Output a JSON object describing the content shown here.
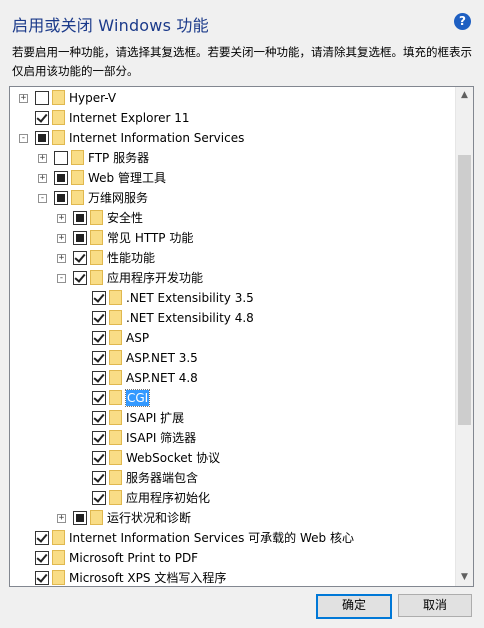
{
  "dialog": {
    "title": "启用或关闭 Windows 功能",
    "description": "若要启用一种功能，请选择其复选框。若要关闭一种功能，请清除其复选框。填充的框表示仅启用该功能的一部分。",
    "help_symbol": "?"
  },
  "features": [
    {
      "label": "Hyper-V",
      "level": 0,
      "expander": "+",
      "state": "unchecked"
    },
    {
      "label": "Internet Explorer 11",
      "level": 0,
      "expander": "",
      "state": "checked"
    },
    {
      "label": "Internet Information Services",
      "level": 0,
      "expander": "-",
      "state": "partial"
    },
    {
      "label": "FTP 服务器",
      "level": 1,
      "expander": "+",
      "state": "unchecked"
    },
    {
      "label": "Web 管理工具",
      "level": 1,
      "expander": "+",
      "state": "partial"
    },
    {
      "label": "万维网服务",
      "level": 1,
      "expander": "-",
      "state": "partial"
    },
    {
      "label": "安全性",
      "level": 2,
      "expander": "+",
      "state": "partial"
    },
    {
      "label": "常见 HTTP 功能",
      "level": 2,
      "expander": "+",
      "state": "partial"
    },
    {
      "label": "性能功能",
      "level": 2,
      "expander": "+",
      "state": "checked"
    },
    {
      "label": "应用程序开发功能",
      "level": 2,
      "expander": "-",
      "state": "checked"
    },
    {
      "label": ".NET Extensibility 3.5",
      "level": 3,
      "expander": "",
      "state": "checked"
    },
    {
      "label": ".NET Extensibility 4.8",
      "level": 3,
      "expander": "",
      "state": "checked"
    },
    {
      "label": "ASP",
      "level": 3,
      "expander": "",
      "state": "checked"
    },
    {
      "label": "ASP.NET 3.5",
      "level": 3,
      "expander": "",
      "state": "checked"
    },
    {
      "label": "ASP.NET 4.8",
      "level": 3,
      "expander": "",
      "state": "checked"
    },
    {
      "label": "CGI",
      "level": 3,
      "expander": "",
      "state": "checked",
      "selected": true
    },
    {
      "label": "ISAPI 扩展",
      "level": 3,
      "expander": "",
      "state": "checked"
    },
    {
      "label": "ISAPI 筛选器",
      "level": 3,
      "expander": "",
      "state": "checked"
    },
    {
      "label": "WebSocket 协议",
      "level": 3,
      "expander": "",
      "state": "checked"
    },
    {
      "label": "服务器端包含",
      "level": 3,
      "expander": "",
      "state": "checked"
    },
    {
      "label": "应用程序初始化",
      "level": 3,
      "expander": "",
      "state": "checked"
    },
    {
      "label": "运行状况和诊断",
      "level": 2,
      "expander": "+",
      "state": "partial"
    },
    {
      "label": "Internet Information Services 可承载的 Web 核心",
      "level": 0,
      "expander": "",
      "state": "checked"
    },
    {
      "label": "Microsoft Print to PDF",
      "level": 0,
      "expander": "",
      "state": "checked"
    },
    {
      "label": "Microsoft XPS 文档写入程序",
      "level": 0,
      "expander": "",
      "state": "checked"
    }
  ],
  "scrollbar": {
    "up_arrow": "▲",
    "down_arrow": "▼"
  },
  "buttons": {
    "ok": "确定",
    "cancel": "取消"
  }
}
